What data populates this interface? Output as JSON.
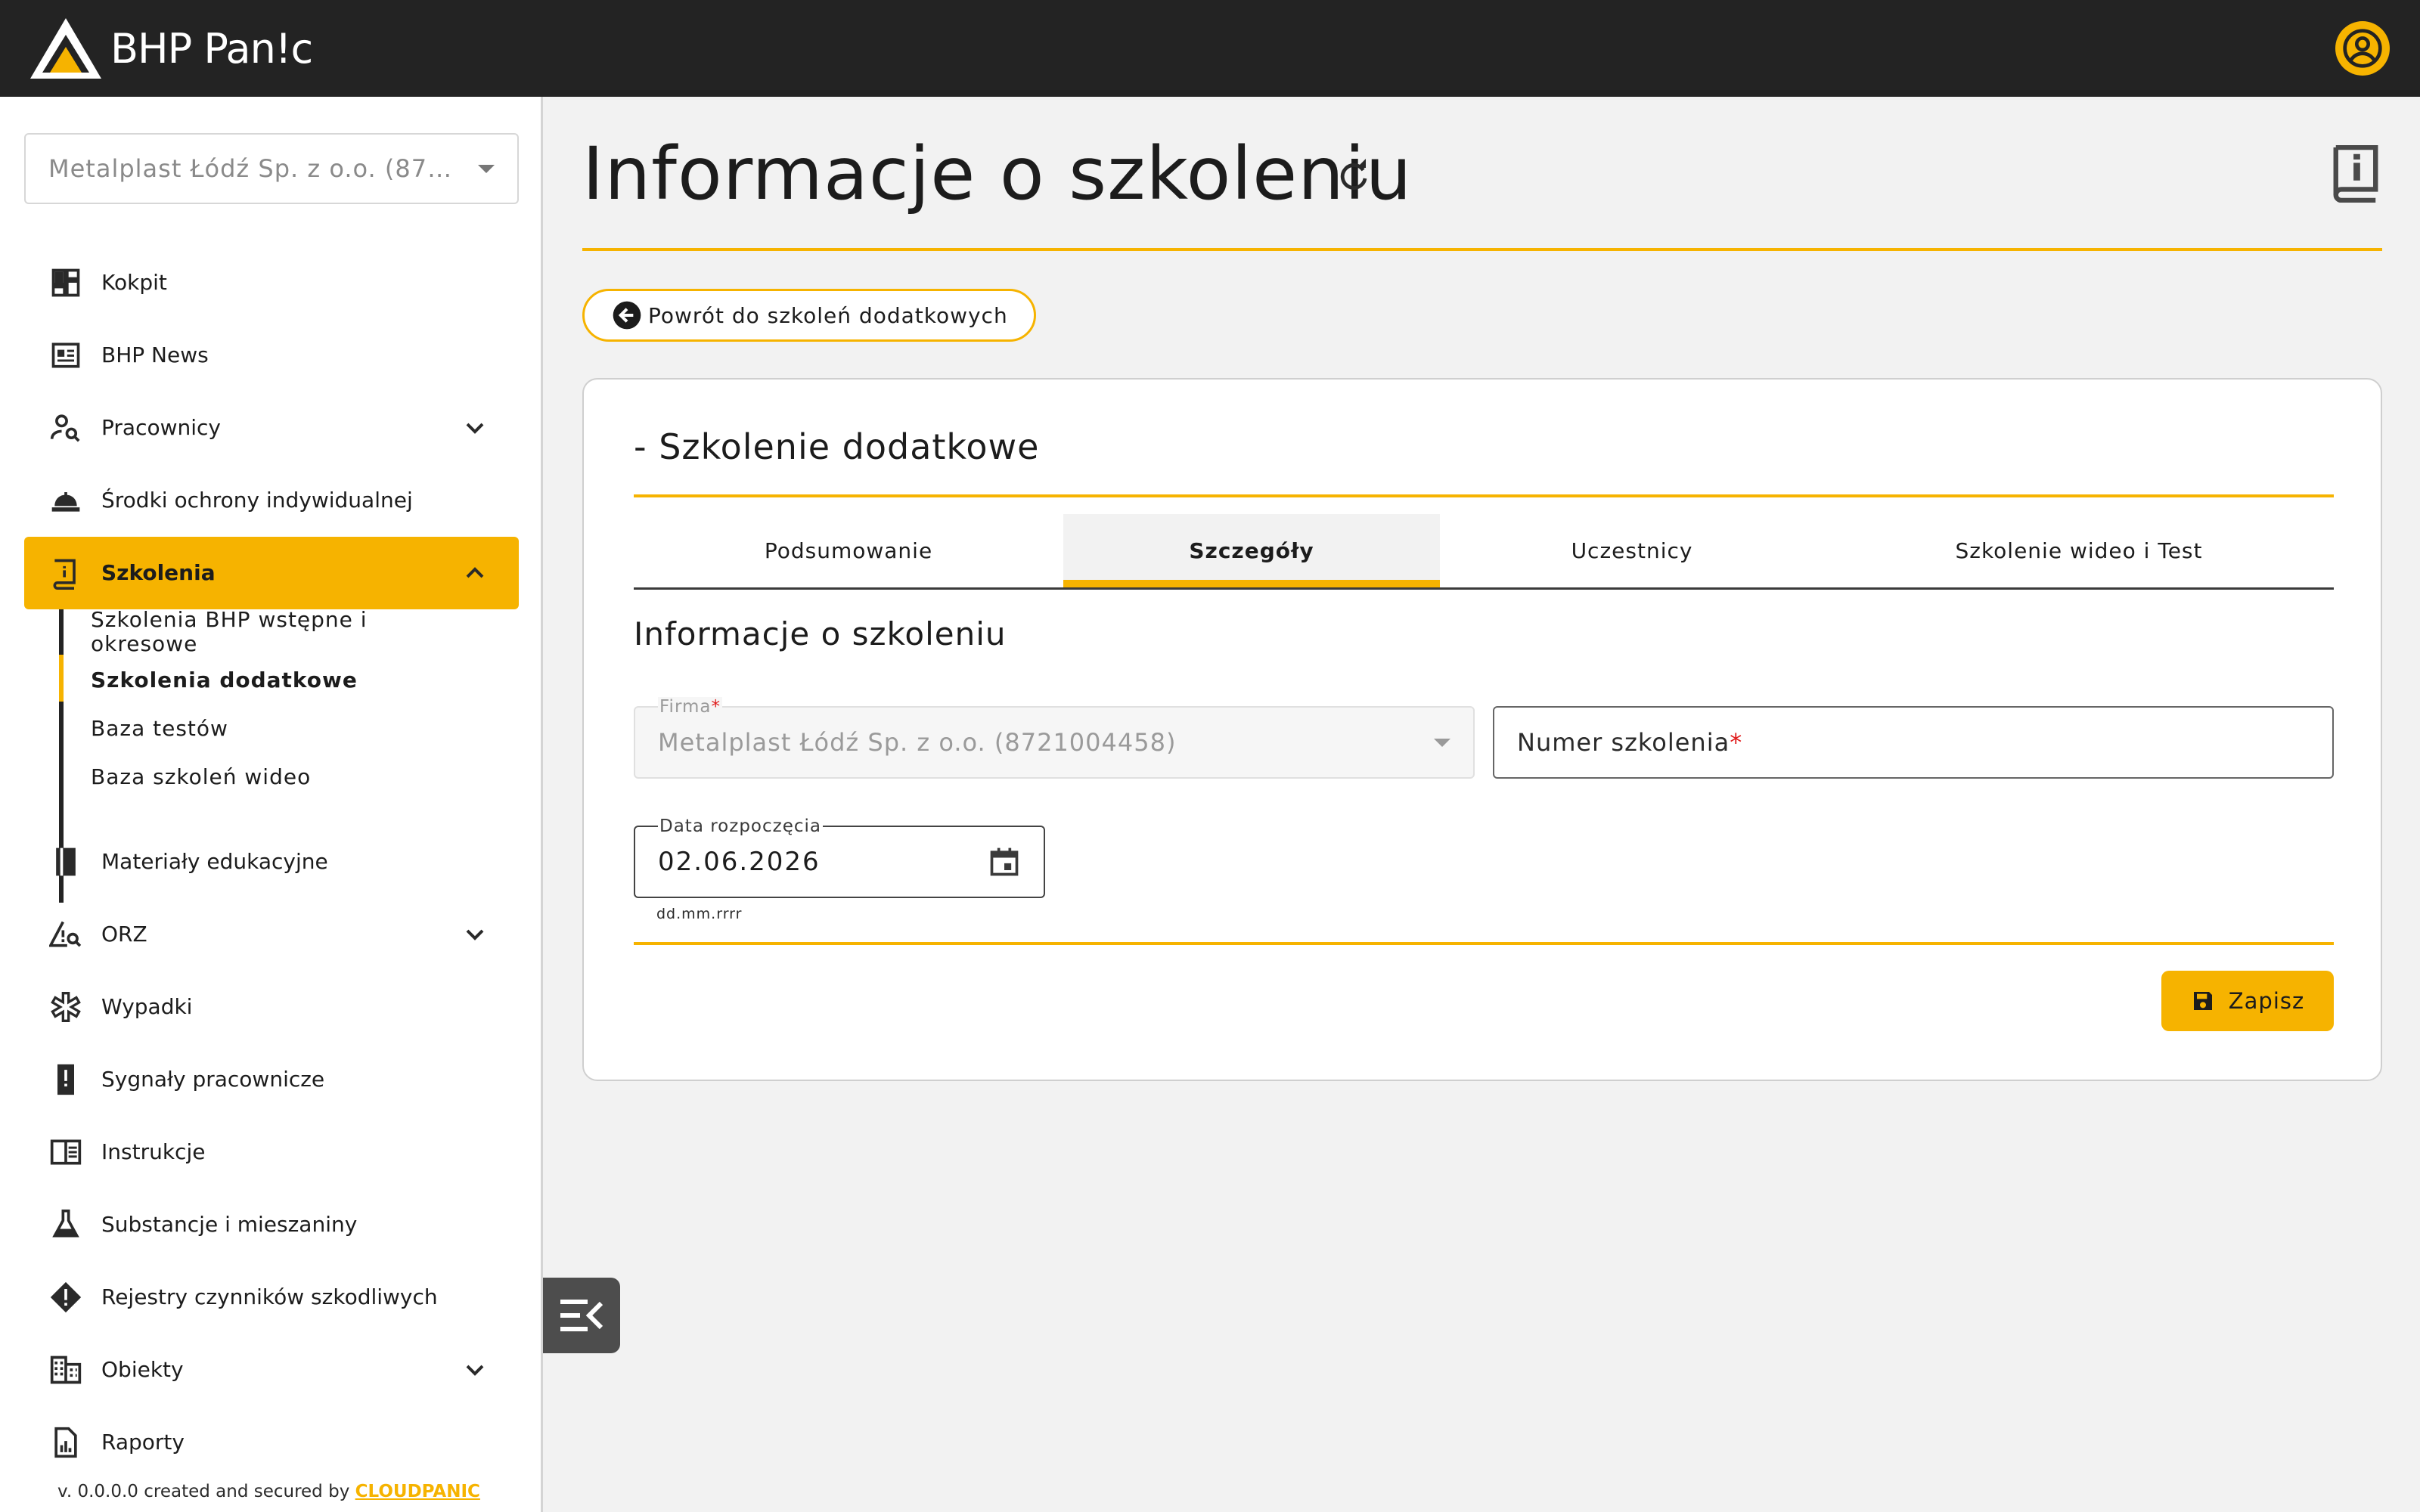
{
  "header": {
    "logo_text": "BHP Pan!c",
    "logo_icon": "bhp-panic-triangle-logo",
    "user_icon": "account-circle-icon",
    "accent": "#f6b300",
    "bar_color": "#232323"
  },
  "sidebar": {
    "company_select": "Metalplast Łódź Sp. z o.o. (8721004458)",
    "items": [
      {
        "label": "Kokpit",
        "icon": "dashboard-icon"
      },
      {
        "label": "BHP News",
        "icon": "newspaper-icon"
      },
      {
        "label": "Pracownicy",
        "icon": "person-search-icon",
        "expandable": true
      },
      {
        "label": "Środki ochrony indywidualnej",
        "icon": "hard-hat-icon"
      },
      {
        "label": "Szkolenia",
        "icon": "training-book-icon",
        "expandable": true,
        "active": true
      },
      {
        "label": "Materiały edukacyjne",
        "icon": "book-icon"
      },
      {
        "label": "ORZ",
        "icon": "risk-search-icon",
        "expandable": true
      },
      {
        "label": "Wypadki",
        "icon": "medical-star-icon"
      },
      {
        "label": "Sygnały pracownicze",
        "icon": "alert-phone-icon"
      },
      {
        "label": "Instrukcje",
        "icon": "chrome-reader-icon"
      },
      {
        "label": "Substancje i mieszaniny",
        "icon": "flask-icon"
      },
      {
        "label": "Rejestry czynników szkodliwych",
        "icon": "warning-diamond-icon"
      },
      {
        "label": "Obiekty",
        "icon": "building-icon",
        "expandable": true
      },
      {
        "label": "Raporty",
        "icon": "report-icon"
      }
    ],
    "sub_items": [
      {
        "label": "Szkolenia BHP wstępne i okresowe"
      },
      {
        "label": "Szkolenia dodatkowe",
        "active": true
      },
      {
        "label": "Baza testów"
      },
      {
        "label": "Baza szkoleń wideo"
      }
    ],
    "footer": {
      "prefix": "v. 0.0.0.0 created and secured by ",
      "brand": "CLOUDPANIC"
    }
  },
  "main": {
    "title": "Informacje o szkoleniu",
    "back_button": "Powrót do szkoleń dodatkowych",
    "card_title": "- Szkolenie dodatkowe",
    "tabs": [
      {
        "label": "Podsumowanie"
      },
      {
        "label": "Szczegóły",
        "active": true
      },
      {
        "label": "Uczestnicy"
      },
      {
        "label": "Szkolenie wideo i Test"
      }
    ],
    "section_title": "Informacje o szkoleniu",
    "form": {
      "firma_label": "Firma",
      "firma_value": "Metalplast Łódź Sp. z o.o. (8721004458)",
      "numer_label": "Numer szkolenia",
      "date_label": "Data rozpoczęcia",
      "date_value": "02.06.2026",
      "date_hint": "dd.mm.rrrr",
      "required_mark": "*"
    },
    "save_button": "Zapisz"
  }
}
